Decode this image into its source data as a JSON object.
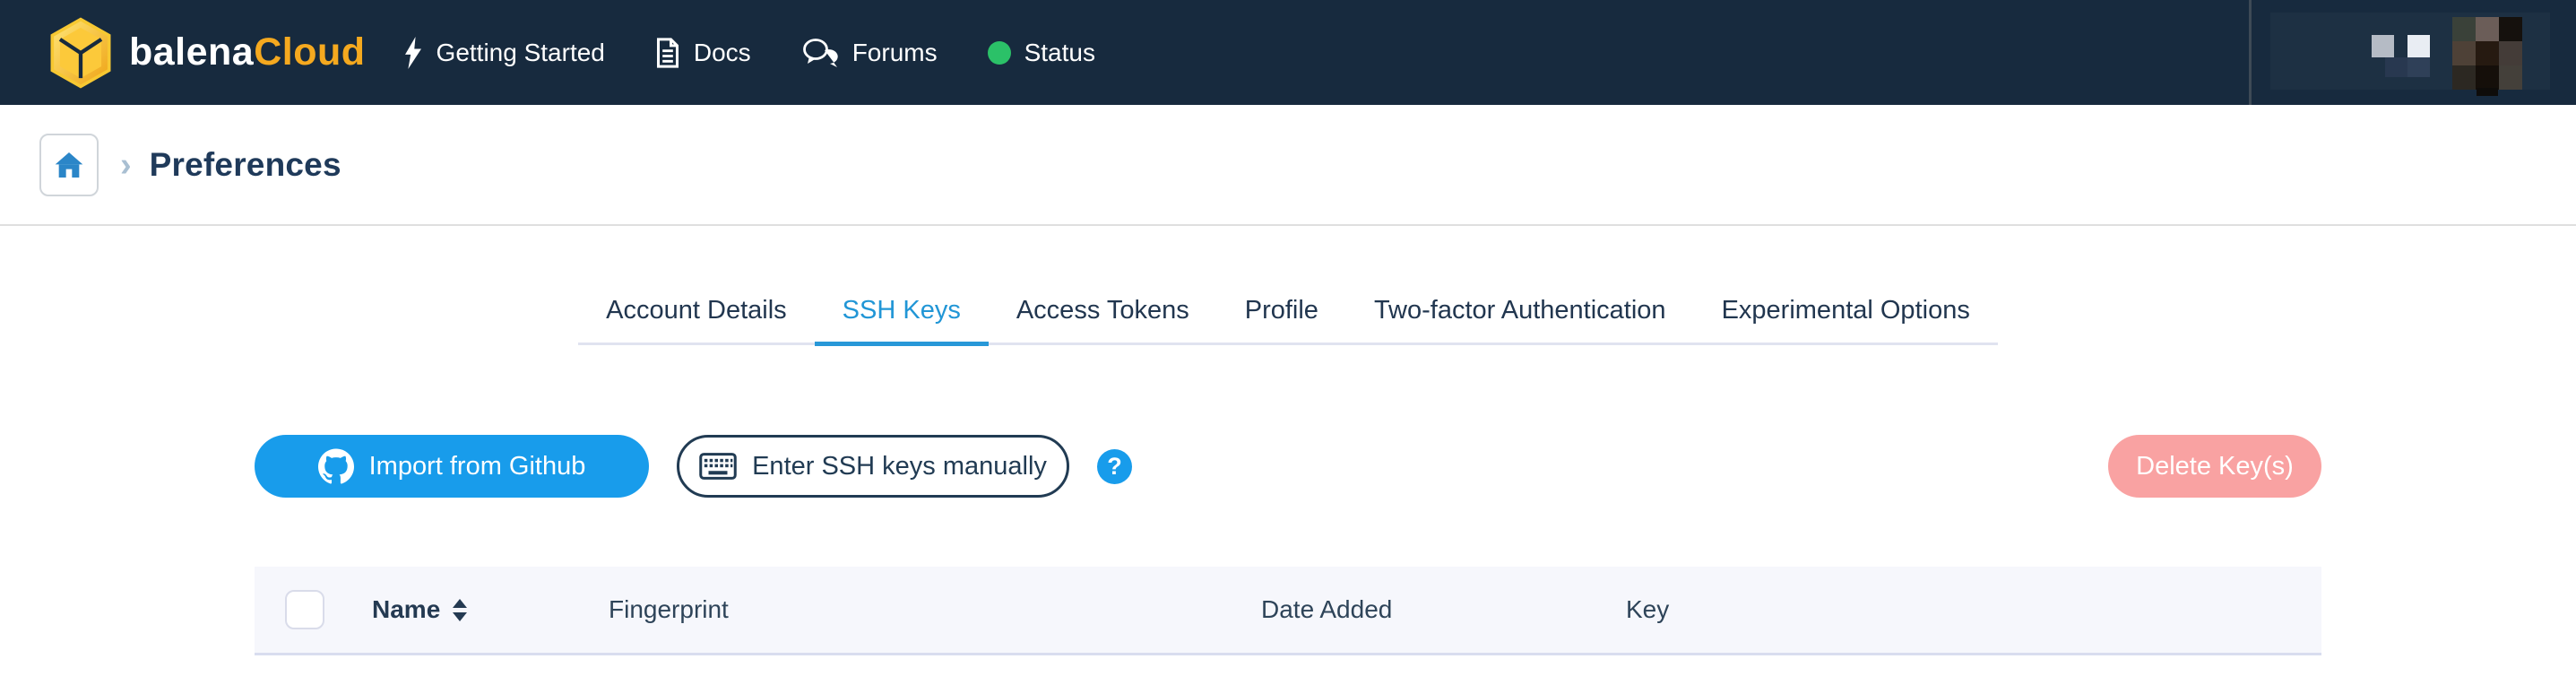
{
  "colors": {
    "navbar_bg": "#172a3e",
    "brand_yellow": "#f5a91f",
    "accent": "#189ceb",
    "active_tab": "#2196d6",
    "tab_underline": "#2898d8",
    "delete_pink": "#f9a2a2",
    "status_green": "#2bc168",
    "header_bg": "#f6f7fc",
    "home_blue": "#2b86c8"
  },
  "navbar": {
    "brand": {
      "left": "balena",
      "right": "Cloud",
      "logo_icon": "balena-cube-icon"
    },
    "links": [
      {
        "label": "Getting Started",
        "icon": "lightning-icon"
      },
      {
        "label": "Docs",
        "icon": "document-icon"
      },
      {
        "label": "Forums",
        "icon": "chat-bubbles-icon"
      },
      {
        "label": "Status",
        "icon": "status-dot-icon"
      }
    ],
    "user_area": "redacted-pixelated"
  },
  "breadcrumb": {
    "home_icon": "home-icon",
    "separator": "›",
    "current": "Preferences"
  },
  "tabs": {
    "items": [
      {
        "label": "Account Details",
        "active": false
      },
      {
        "label": "SSH Keys",
        "active": true
      },
      {
        "label": "Access Tokens",
        "active": false
      },
      {
        "label": "Profile",
        "active": false
      },
      {
        "label": "Two-factor Authentication",
        "active": false
      },
      {
        "label": "Experimental Options",
        "active": false
      }
    ]
  },
  "toolbar": {
    "import_github_label": "Import from Github",
    "import_github_icon": "github-icon",
    "enter_manual_label": "Enter SSH keys manually",
    "enter_manual_icon": "keyboard-icon",
    "help_glyph": "?",
    "delete_label": "Delete Key(s)",
    "delete_enabled": false
  },
  "table": {
    "columns": [
      {
        "label": "Name",
        "sortable": true
      },
      {
        "label": "Fingerprint",
        "sortable": false
      },
      {
        "label": "Date Added",
        "sortable": false
      },
      {
        "label": "Key",
        "sortable": false
      }
    ],
    "rows": []
  }
}
